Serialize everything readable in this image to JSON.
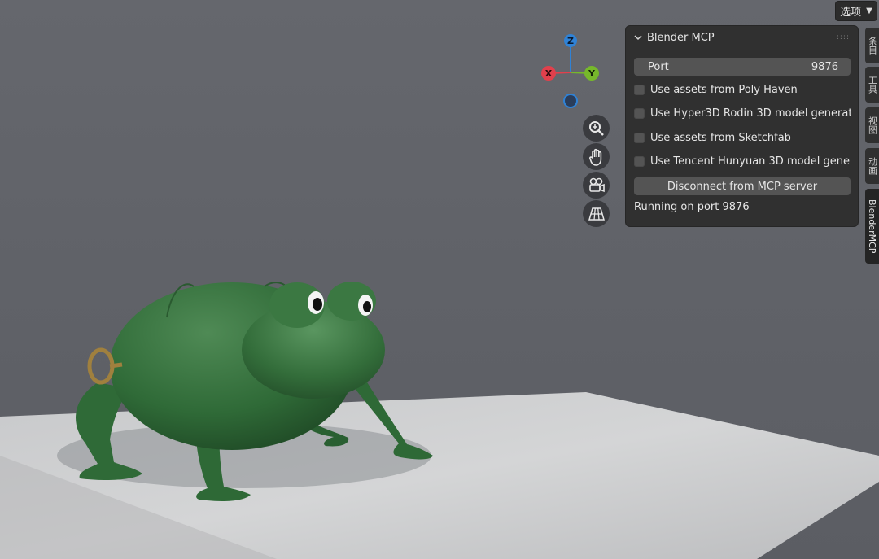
{
  "toolbar": {
    "options_label": "选项"
  },
  "gizmo": {
    "axis_z": "Z",
    "axis_y": "Y",
    "axis_x": "X",
    "colors": {
      "x": "#e1404c",
      "y": "#76b82b",
      "z": "#2f82d6"
    }
  },
  "nav_buttons": [
    {
      "icon": "zoom-icon"
    },
    {
      "icon": "pan-hand-icon"
    },
    {
      "icon": "camera-icon"
    },
    {
      "icon": "perspective-grid-icon"
    }
  ],
  "panel": {
    "title": "Blender MCP",
    "port_label": "Port",
    "port_value": "9876",
    "checkboxes": [
      {
        "label": "Use assets from Poly Haven",
        "checked": false
      },
      {
        "label": "Use Hyper3D Rodin 3D model generati...",
        "checked": false
      },
      {
        "label": "Use assets from Sketchfab",
        "checked": false
      },
      {
        "label": "Use Tencent Hunyuan 3D model gene...",
        "checked": false
      }
    ],
    "disconnect_label": "Disconnect from MCP server",
    "status": "Running on port 9876"
  },
  "side_tabs": [
    {
      "label": "条目",
      "active": false
    },
    {
      "label": "工具",
      "active": false
    },
    {
      "label": "视图",
      "active": false
    },
    {
      "label": "动画",
      "active": false
    },
    {
      "label": "BlenderMCP",
      "active": true
    }
  ]
}
